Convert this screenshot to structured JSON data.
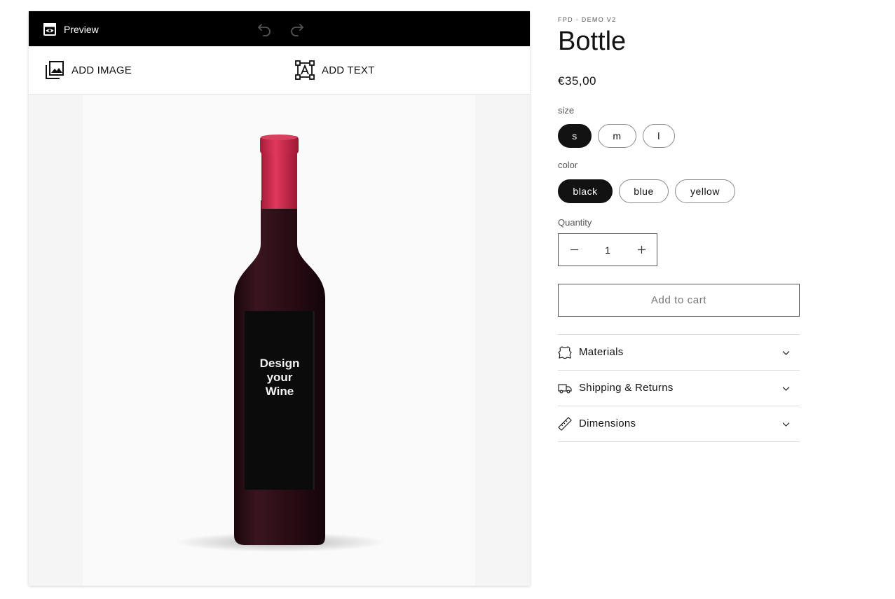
{
  "designer": {
    "preview_label": "Preview",
    "add_image_label": "ADD IMAGE",
    "add_text_label": "ADD TEXT",
    "label_text": [
      "Design",
      "your",
      "Wine"
    ]
  },
  "product": {
    "vendor": "FPD - DEMO V2",
    "title": "Bottle",
    "price": "€35,00",
    "size": {
      "label": "size",
      "options": [
        "s",
        "m",
        "l"
      ],
      "selected": "s"
    },
    "color": {
      "label": "color",
      "options": [
        "black",
        "blue",
        "yellow"
      ],
      "selected": "black"
    },
    "quantity": {
      "label": "Quantity",
      "value": "1"
    },
    "add_to_cart": "Add to cart",
    "accordions": [
      {
        "label": "Materials",
        "icon": "leather-icon"
      },
      {
        "label": "Shipping & Returns",
        "icon": "truck-icon"
      },
      {
        "label": "Dimensions",
        "icon": "ruler-icon"
      }
    ]
  },
  "colors": {
    "accent": "#121212",
    "capsule": "#c8264a",
    "bottle": "#2b0d14"
  }
}
